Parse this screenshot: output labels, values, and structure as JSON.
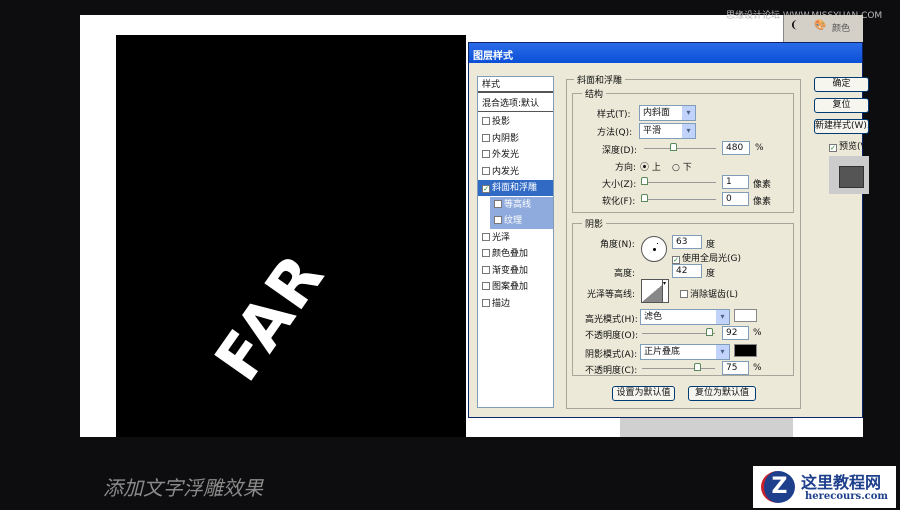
{
  "watermark": "思缘设计论坛 WWW.MISSYUAN.COM",
  "panel_tab": {
    "color_label": "颜色"
  },
  "artwork_text": "FAR",
  "dialog": {
    "title": "图层样式",
    "styles_header": "样式",
    "blend_options": "混合选项:默认",
    "effects": [
      {
        "label": "投影",
        "checked": false
      },
      {
        "label": "内阴影",
        "checked": false
      },
      {
        "label": "外发光",
        "checked": false
      },
      {
        "label": "内发光",
        "checked": false
      },
      {
        "label": "斜面和浮雕",
        "checked": true
      },
      {
        "label": "等高线",
        "checked": false
      },
      {
        "label": "纹理",
        "checked": false
      },
      {
        "label": "光泽",
        "checked": false
      },
      {
        "label": "颜色叠加",
        "checked": false
      },
      {
        "label": "渐变叠加",
        "checked": false
      },
      {
        "label": "图案叠加",
        "checked": false
      },
      {
        "label": "描边",
        "checked": false
      }
    ],
    "bevel": {
      "title": "斜面和浮雕",
      "structure": "结构",
      "style_label": "样式(T):",
      "style_value": "内斜面",
      "technique_label": "方法(Q):",
      "technique_value": "平滑",
      "depth_label": "深度(D):",
      "depth_value": "480",
      "depth_unit": "%",
      "depth_slider": 0.4,
      "direction_label": "方向:",
      "dir_up": "上",
      "dir_down": "下",
      "size_label": "大小(Z):",
      "size_value": "1",
      "size_unit": "像素",
      "soften_label": "软化(F):",
      "soften_value": "0",
      "soften_unit": "像素"
    },
    "shading": {
      "title": "阴影",
      "angle_label": "角度(N):",
      "angle_value": "63",
      "angle_unit": "度",
      "global_light": "使用全局光(G)",
      "altitude_label": "高度:",
      "altitude_value": "42",
      "altitude_unit": "度",
      "gloss_label": "光泽等高线:",
      "antialias": "消除锯齿(L)",
      "highlight_label": "高光模式(H):",
      "highlight_mode": "滤色",
      "highlight_color": "#ffffff",
      "hl_opacity_label": "不透明度(O):",
      "hl_opacity": "92",
      "hl_opacity_unit": "%",
      "shadow_label": "阴影模式(A):",
      "shadow_mode": "正片叠底",
      "shadow_color": "#000000",
      "sh_opacity_label": "不透明度(C):",
      "sh_opacity": "75",
      "sh_opacity_unit": "%"
    },
    "make_default": "设置为默认值",
    "reset_default": "复位为默认值",
    "ok": "确定",
    "reset": "复位",
    "new_style": "新建样式(W)...",
    "preview": "预览(V)"
  },
  "caption": "添加文字浮雕效果",
  "logo": {
    "title": "这里教程网",
    "url": "herecours.com"
  }
}
